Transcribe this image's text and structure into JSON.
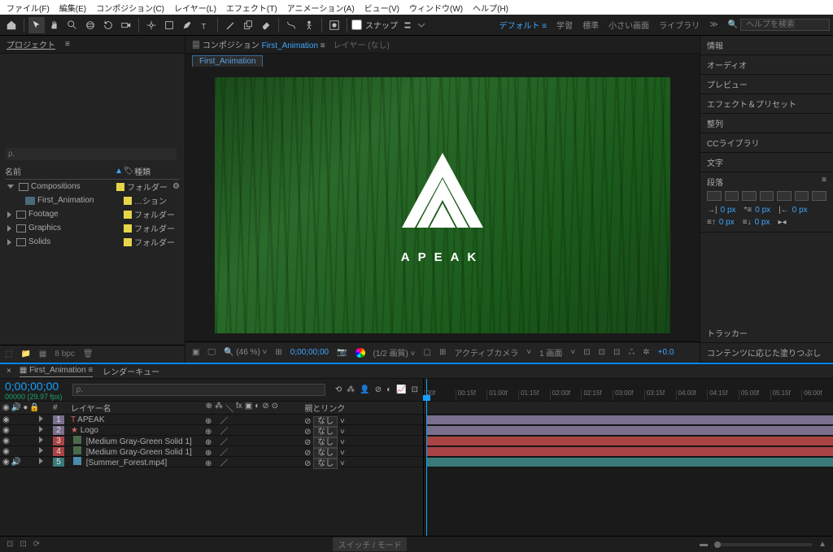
{
  "menu": {
    "file": "ファイル(F)",
    "edit": "編集(E)",
    "comp": "コンポジション(C)",
    "layer": "レイヤー(L)",
    "effect": "エフェクト(T)",
    "anim": "アニメーション(A)",
    "view": "ビュー(V)",
    "window": "ウィンドウ(W)",
    "help": "ヘルプ(H)"
  },
  "toolbar": {
    "snap": "スナップ"
  },
  "workspace": {
    "default": "デフォルト",
    "learn": "学習",
    "standard": "標準",
    "small": "小さい画面",
    "library": "ライブラリ",
    "search_ph": "ヘルプを検索"
  },
  "project": {
    "title": "プロジェクト",
    "col_name": "名前",
    "col_type": "種類",
    "items": [
      {
        "name": "Compositions",
        "type": "フォルダー"
      },
      {
        "name": "First_Animation",
        "type": "…ション"
      },
      {
        "name": "Footage",
        "type": "フォルダー"
      },
      {
        "name": "Graphics",
        "type": "フォルダー"
      },
      {
        "name": "Solids",
        "type": "フォルダー"
      }
    ],
    "bpc": "8 bpc"
  },
  "viewer": {
    "comp_label": "コンポジション",
    "comp_name": "First_Animation",
    "layer_tab": "レイヤー (なし)",
    "tab": "First_Animation",
    "brand": "APEAK",
    "zoom": "(46 %)",
    "timecode": "0;00;00;00",
    "quality": "(1/2 画質)",
    "camera": "アクティブカメラ",
    "views": "1 画面",
    "exp": "+0.0"
  },
  "right": {
    "panels": [
      "情報",
      "オーディオ",
      "プレビュー",
      "エフェクト＆プリセット",
      "整列",
      "CCライブラリ",
      "文字"
    ],
    "paragraph": "段落",
    "px": "0 px",
    "tracker": "トラッカー",
    "contentfill": "コンテンツに応じた塗りつぶし"
  },
  "timeline": {
    "tab_active": "First_Animation",
    "tab_render": "レンダーキュー",
    "timecode": "0;00;00;00",
    "rate": "00000 (29.97 fps)",
    "col_num": "#",
    "col_layer": "レイヤー名",
    "col_parent": "親とリンク",
    "none": "なし",
    "layers": [
      {
        "n": "1",
        "name": "APEAK",
        "c": "sw1"
      },
      {
        "n": "2",
        "name": "Logo",
        "c": "sw2"
      },
      {
        "n": "3",
        "name": "[Medium Gray-Green Solid 1]",
        "c": "sw3"
      },
      {
        "n": "4",
        "name": "[Medium Gray-Green Solid 1]",
        "c": "sw4"
      },
      {
        "n": "5",
        "name": "[Summer_Forest.mp4]",
        "c": "sw5"
      }
    ],
    "ruler": [
      "00f",
      "00:15f",
      "01:00f",
      "01:15f",
      "02:00f",
      "02:15f",
      "03:00f",
      "03:15f",
      "04:00f",
      "04:15f",
      "05:00f",
      "05:15f",
      "06:00f"
    ],
    "switches": "スイッチ / モード"
  }
}
